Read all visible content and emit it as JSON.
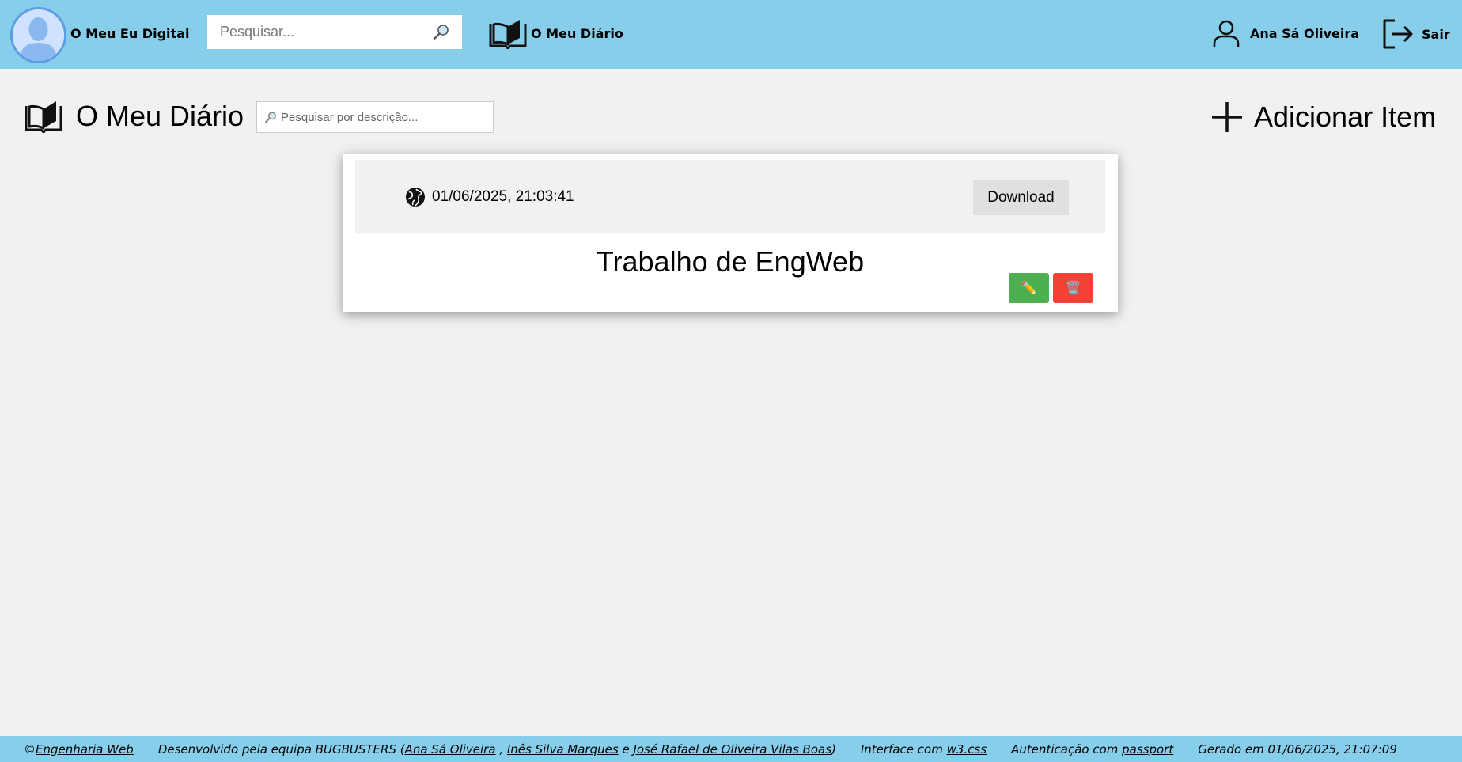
{
  "nav": {
    "brand": "O Meu Eu Digital",
    "search_placeholder": "Pesquisar...",
    "diario_label": "O Meu Diário",
    "user_name": "Ana Sá Oliveira",
    "exit_label": "Sair"
  },
  "page": {
    "title": "O Meu Diário",
    "desc_search_placeholder": "Pesquisar por descrição...",
    "add_item_label": "Adicionar Item"
  },
  "card": {
    "visibility_icon": "globe-icon",
    "date": "01/06/2025, 21:03:41",
    "download_label": "Download",
    "title": "Trabalho de EngWeb",
    "edit_icon": "✏️",
    "delete_icon": "🗑️"
  },
  "footer": {
    "copyright": "© ",
    "engweb_link": "Engenharia Web",
    "dev_prefix": "Desenvolvido pela equipa BUGBUSTERS (",
    "member1": "Ana Sá Oliveira",
    "sep1": " , ",
    "member2": "Inês Silva Marques",
    "sep2": " e ",
    "member3": "José Rafael de Oliveira Vilas Boas",
    "dev_suffix": ")",
    "interface_prefix": "Interface com ",
    "interface_link": "w3.css",
    "auth_prefix": "Autenticação com ",
    "auth_link": "passport",
    "generated": "Gerado em 01/06/2025, 21:07:09"
  },
  "colors": {
    "bar": "#87ceeb",
    "background": "#f1f1f1",
    "edit": "#4caf50",
    "delete": "#f44336"
  }
}
